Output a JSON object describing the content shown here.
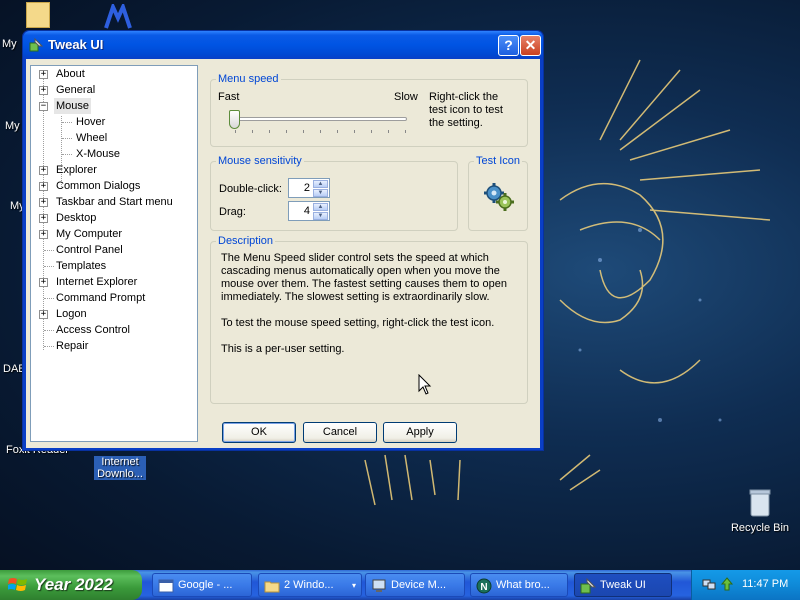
{
  "window": {
    "title": "Tweak UI",
    "help_btn": "?",
    "close_btn": "✕"
  },
  "tree": {
    "items": [
      {
        "label": "About",
        "expander": "+"
      },
      {
        "label": "General",
        "expander": "+"
      },
      {
        "label": "Mouse",
        "expander": "−"
      },
      {
        "label": "Hover"
      },
      {
        "label": "Wheel"
      },
      {
        "label": "X-Mouse"
      },
      {
        "label": "Explorer",
        "expander": "+"
      },
      {
        "label": "Common Dialogs",
        "expander": "+"
      },
      {
        "label": "Taskbar and Start menu",
        "expander": "+"
      },
      {
        "label": "Desktop",
        "expander": "+"
      },
      {
        "label": "My Computer",
        "expander": "+"
      },
      {
        "label": "Control Panel"
      },
      {
        "label": "Templates"
      },
      {
        "label": "Internet Explorer",
        "expander": "+"
      },
      {
        "label": "Command Prompt"
      },
      {
        "label": "Logon",
        "expander": "+"
      },
      {
        "label": "Access Control"
      },
      {
        "label": "Repair"
      }
    ]
  },
  "menu_speed": {
    "title": "Menu speed",
    "fast_label": "Fast",
    "slow_label": "Slow",
    "hint": [
      "Right-click the",
      "test icon to test",
      "the setting."
    ]
  },
  "mouse_sensitivity": {
    "title": "Mouse sensitivity",
    "double_click_label": "Double-click:",
    "double_click_value": "2",
    "drag_label": "Drag:",
    "drag_value": "4"
  },
  "test_icon": {
    "title": "Test Icon",
    "icon": "gears-icon"
  },
  "description": {
    "title": "Description",
    "paragraphs": [
      "The Menu Speed slider control sets the speed at which cascading menus automatically open when you move the mouse over them.  The fastest setting causes them to open immediately.  The slowest setting is extraordinarily slow.",
      "To test the mouse speed setting, right-click the test icon.",
      "This is a per-user setting."
    ]
  },
  "buttons": {
    "ok": "OK",
    "cancel": "Cancel",
    "apply": "Apply"
  },
  "desktop": {
    "labels": [
      "My",
      "My",
      "My",
      "DAE",
      "Recycle Bin",
      "Internet Downlo...",
      "Foxit Reader"
    ]
  },
  "taskbar": {
    "start_label": "Year 2022",
    "tasks": [
      {
        "label": "Google - ...",
        "icon": "browser-icon"
      },
      {
        "label": "2 Windo...",
        "icon": "folder-icon",
        "arrow": "▾"
      },
      {
        "label": "Device M...",
        "icon": "device-manager-icon"
      },
      {
        "label": "What bro...",
        "icon": "netscape-icon"
      },
      {
        "label": "Tweak UI",
        "icon": "tweakui-icon"
      }
    ],
    "clock": "11:47 PM"
  },
  "colors": {
    "titlebar": "#0054e3",
    "group_title": "#0046d5",
    "dialog_bg": "#ece9d8",
    "start_green": "#3c9c3c",
    "tray_blue": "#0f8ad8"
  }
}
